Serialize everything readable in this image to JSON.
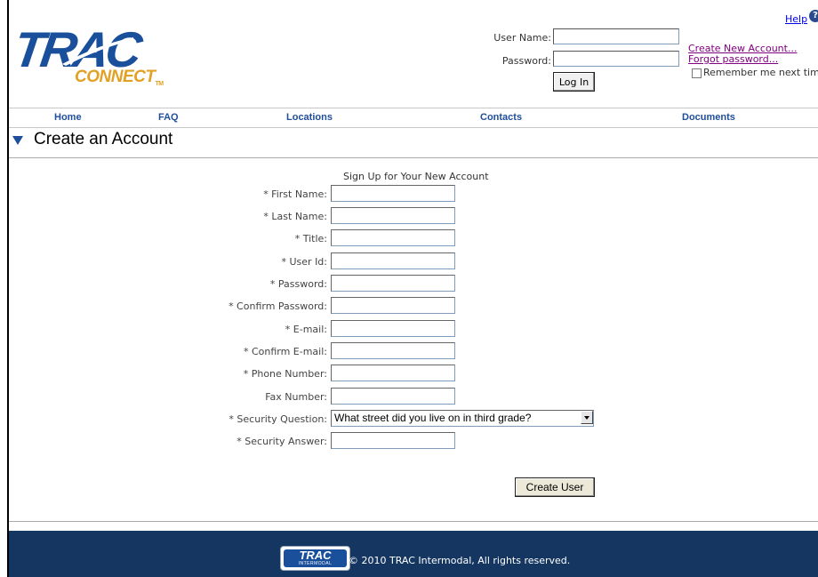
{
  "brand": {
    "logo_main": "TRAC",
    "logo_sub": "CONNECT",
    "logo_tm": "TM"
  },
  "header": {
    "help_label": "Help",
    "username_label": "User Name:",
    "password_label": "Password:",
    "login_button": "Log In",
    "create_account_link": "Create New Account...",
    "forgot_password_link": "Forgot password...",
    "remember_label": "Remember me next time"
  },
  "nav": {
    "items": [
      "Home",
      "FAQ",
      "Locations",
      "Contacts",
      "Documents"
    ]
  },
  "page": {
    "title": "Create an Account"
  },
  "form": {
    "heading": "Sign Up for Your New Account",
    "fields": [
      {
        "label": "* First Name:",
        "value": ""
      },
      {
        "label": "* Last Name:",
        "value": ""
      },
      {
        "label": "* Title:",
        "value": ""
      },
      {
        "label": "* User Id:",
        "value": ""
      },
      {
        "label": "* Password:",
        "value": ""
      },
      {
        "label": "* Confirm Password:",
        "value": ""
      },
      {
        "label": "* E-mail:",
        "value": ""
      },
      {
        "label": "* Confirm E-mail:",
        "value": ""
      },
      {
        "label": "* Phone Number:",
        "value": ""
      },
      {
        "label": "Fax Number:",
        "value": ""
      }
    ],
    "security_question_label": "* Security Question:",
    "security_question_value": "What street did you live on in third grade?",
    "security_answer_label": "* Security Answer:",
    "submit_button": "Create User"
  },
  "footer": {
    "logo_main": "TRAC",
    "logo_sub": "INTERMODAL",
    "copyright": "© 2010 TRAC Intermodal, All rights reserved."
  },
  "colors": {
    "brand_blue": "#1a4f9c",
    "brand_gold": "#e2a124",
    "footer_navy": "#153661",
    "visited_link": "#800080"
  }
}
